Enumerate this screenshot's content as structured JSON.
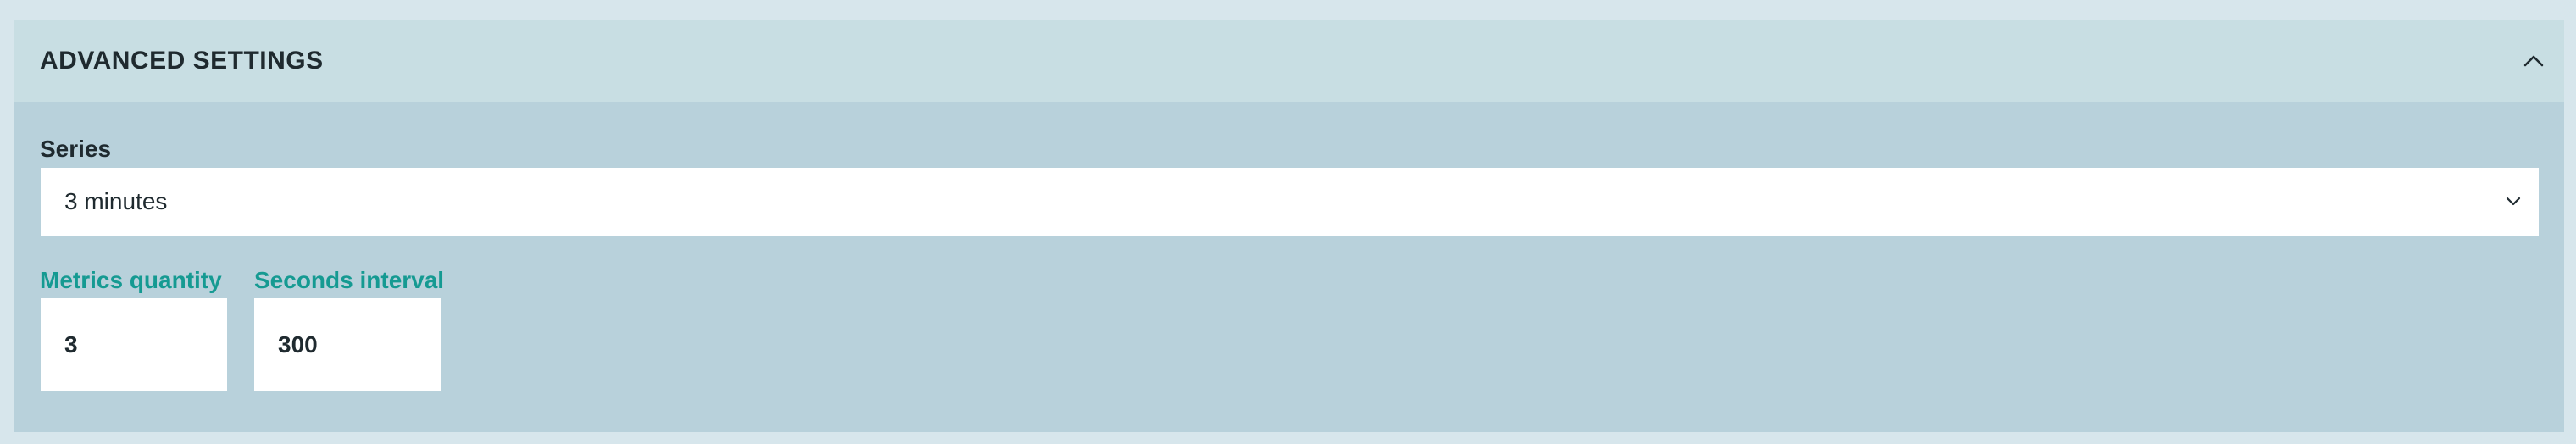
{
  "panel": {
    "title": "ADVANCED SETTINGS",
    "collapse_icon": "chevron-up-icon"
  },
  "series": {
    "label": "Series",
    "selected": "3 minutes",
    "dropdown_icon": "chevron-down-icon"
  },
  "metrics_quantity": {
    "label": "Metrics quantity",
    "value": "3"
  },
  "seconds_interval": {
    "label": "Seconds interval",
    "value": "300"
  },
  "colors": {
    "page_background": "#d7e6ec",
    "panel_background": "#b8d1db",
    "header_background": "#c8dee3",
    "accent_label": "#159a92",
    "text": "#1f2a2f"
  }
}
